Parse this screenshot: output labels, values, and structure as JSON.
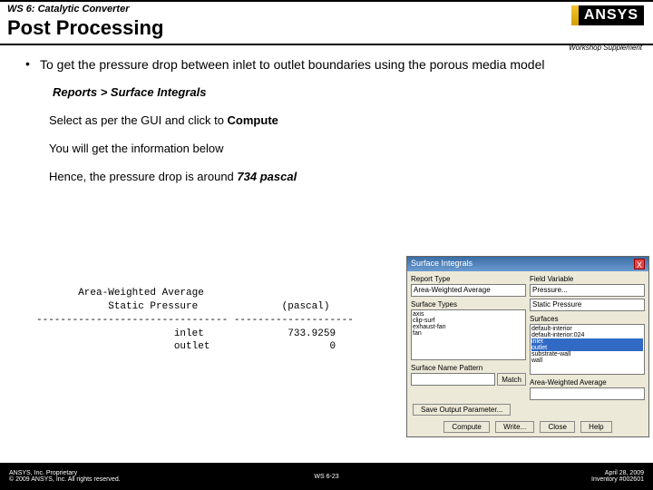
{
  "header": {
    "ws_title": "WS 6: Catalytic Converter",
    "main_title": "Post Processing",
    "supplement": "Workshop Supplement",
    "logo_text": "ANSYS"
  },
  "bullet": {
    "marker": "•",
    "text": "To get the pressure drop between inlet to outlet boundaries using the porous media model"
  },
  "subs": {
    "path": "Reports > Surface Integrals",
    "line2a": "Select as per the GUI and click to ",
    "line2b": "Compute",
    "line3": "You will get the information below",
    "line4a": "Hence, the pressure drop is around ",
    "line4b": "734 pascal"
  },
  "report": {
    "text": "       Area-Weighted Average\n            Static Pressure              (pascal)\n-------------------------------- --------------------\n                       inlet              733.9259\n                       outlet                    0"
  },
  "dialog": {
    "title": "Surface Integrals",
    "close": "X",
    "report_type_label": "Report Type",
    "report_type_value": "Area-Weighted Average",
    "field_var_label": "Field Variable",
    "field_var_value": "Pressure...",
    "field_sub_value": "Static Pressure",
    "surface_types_label": "Surface Types",
    "surface_types": [
      "axis",
      "clip-surf",
      "exhaust-fan",
      "fan"
    ],
    "surfaces_label": "Surfaces",
    "surfaces": [
      "default-interior",
      "default-interior:024",
      "inlet",
      "outlet",
      "substrate-wall",
      "wall"
    ],
    "name_pattern_label": "Surface Name Pattern",
    "match_btn": "Match",
    "result_label": "Area-Weighted Average",
    "save_output_label": "Save Output Parameter...",
    "btns": [
      "Compute",
      "Write...",
      "Close",
      "Help"
    ]
  },
  "footer": {
    "left1": "ANSYS, Inc. Proprietary",
    "left2": "© 2009 ANSYS, Inc. All rights reserved.",
    "center": "WS 6-23",
    "right1": "April 28, 2009",
    "right2": "Inventory #002601"
  }
}
